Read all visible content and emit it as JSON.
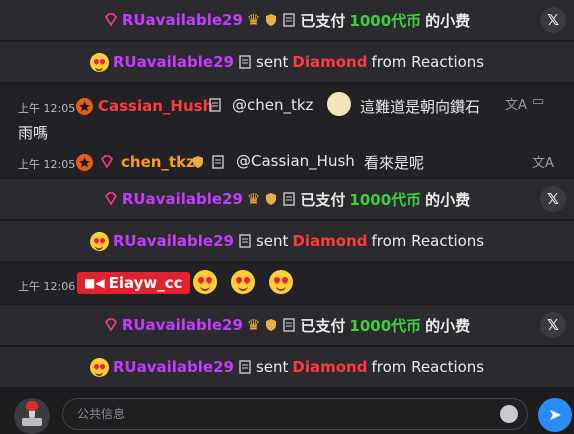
{
  "rows": {
    "gift1": {
      "user": "RUavailable29",
      "text_pre": "已支付",
      "amount": "1000代币",
      "text_post": "的小费"
    },
    "react1": {
      "user": "RUavailable29",
      "sent": "sent",
      "item": "Diamond",
      "from": "from Reactions"
    },
    "msg1": {
      "time": "上午 12:05",
      "user": "Cassian_Hush",
      "mention": "@chen_tkz",
      "text": "這難道是朝向鑽石",
      "text2": "雨嗎"
    },
    "msg2": {
      "time": "上午 12:05",
      "user": "chen_tkz",
      "mention": "@Cassian_Hush",
      "text": "看來是呢"
    },
    "gift2": {
      "user": "RUavailable29",
      "text_pre": "已支付",
      "amount": "1000代币",
      "text_post": "的小费"
    },
    "react2": {
      "user": "RUavailable29",
      "sent": "sent",
      "item": "Diamond",
      "from": "from Reactions"
    },
    "msg3": {
      "time": "上午 12:06",
      "user": "Eiayw_cc"
    },
    "gift3": {
      "user": "RUavailable29",
      "text_pre": "已支付",
      "amount": "1000代币",
      "text_post": "的小费"
    },
    "react3": {
      "user": "RUavailable29",
      "sent": "sent",
      "item": "Diamond",
      "from": "from Reactions"
    }
  },
  "input": {
    "placeholder": "公共信息"
  },
  "colors": {
    "accent": "#2a8cf7",
    "purple": "#c43cff",
    "green": "#3dd13d",
    "red": "#ff3b3b"
  }
}
